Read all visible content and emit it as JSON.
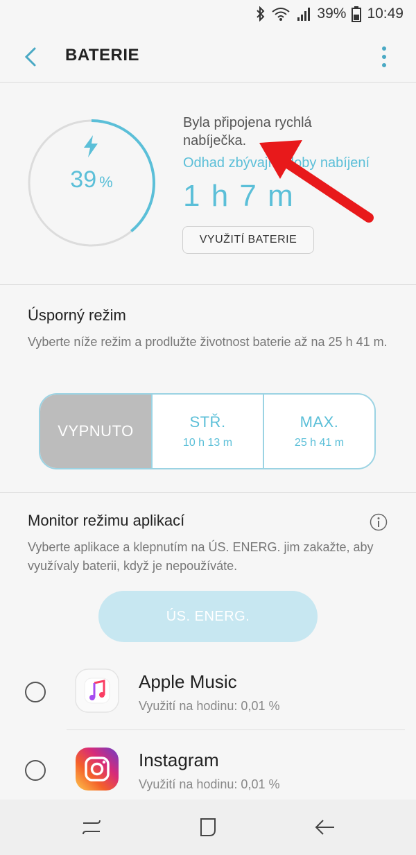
{
  "status_bar": {
    "battery_percent": "39%",
    "time": "10:49",
    "icons": [
      "bluetooth-icon",
      "wifi-icon",
      "signal-icon",
      "battery-icon"
    ]
  },
  "header": {
    "title": "BATERIE",
    "back_icon": "back-arrow-icon",
    "menu_icon": "more-vert-icon"
  },
  "battery": {
    "level_value": "39",
    "level_symbol": "%",
    "level_fraction": 0.39,
    "charger_text": "Byla připojena rychlá nabíječka.",
    "estimate_label": "Odhad zbývající doby nabíjení",
    "estimate_value": "1 h 7 m",
    "usage_button": "VYUŽITÍ BATERIE"
  },
  "saving": {
    "title": "Úsporný režim",
    "description": "Vyberte níže režim a prodlužte životnost baterie až na 25 h 41 m.",
    "modes": [
      {
        "label": "VYPNUTO",
        "sub": "",
        "active": true
      },
      {
        "label": "STŘ.",
        "sub": "10 h 13 m",
        "active": false
      },
      {
        "label": "MAX.",
        "sub": "25 h 41 m",
        "active": false
      }
    ]
  },
  "monitor": {
    "title": "Monitor režimu aplikací",
    "description": "Vyberte aplikace a klepnutím na ÚS. ENERG. jim zakažte, aby využívaly baterii, když je nepoužíváte.",
    "button": "ÚS. ENERG.",
    "apps": [
      {
        "name": "Apple Music",
        "usage": "Využití na hodinu: 0,01 %",
        "icon": "apple-music-icon"
      },
      {
        "name": "Instagram",
        "usage": "Využití na hodinu: 0,01 %",
        "icon": "instagram-icon"
      }
    ]
  },
  "colors": {
    "accent": "#5bbfd8",
    "annotation_arrow": "#e8191b"
  }
}
